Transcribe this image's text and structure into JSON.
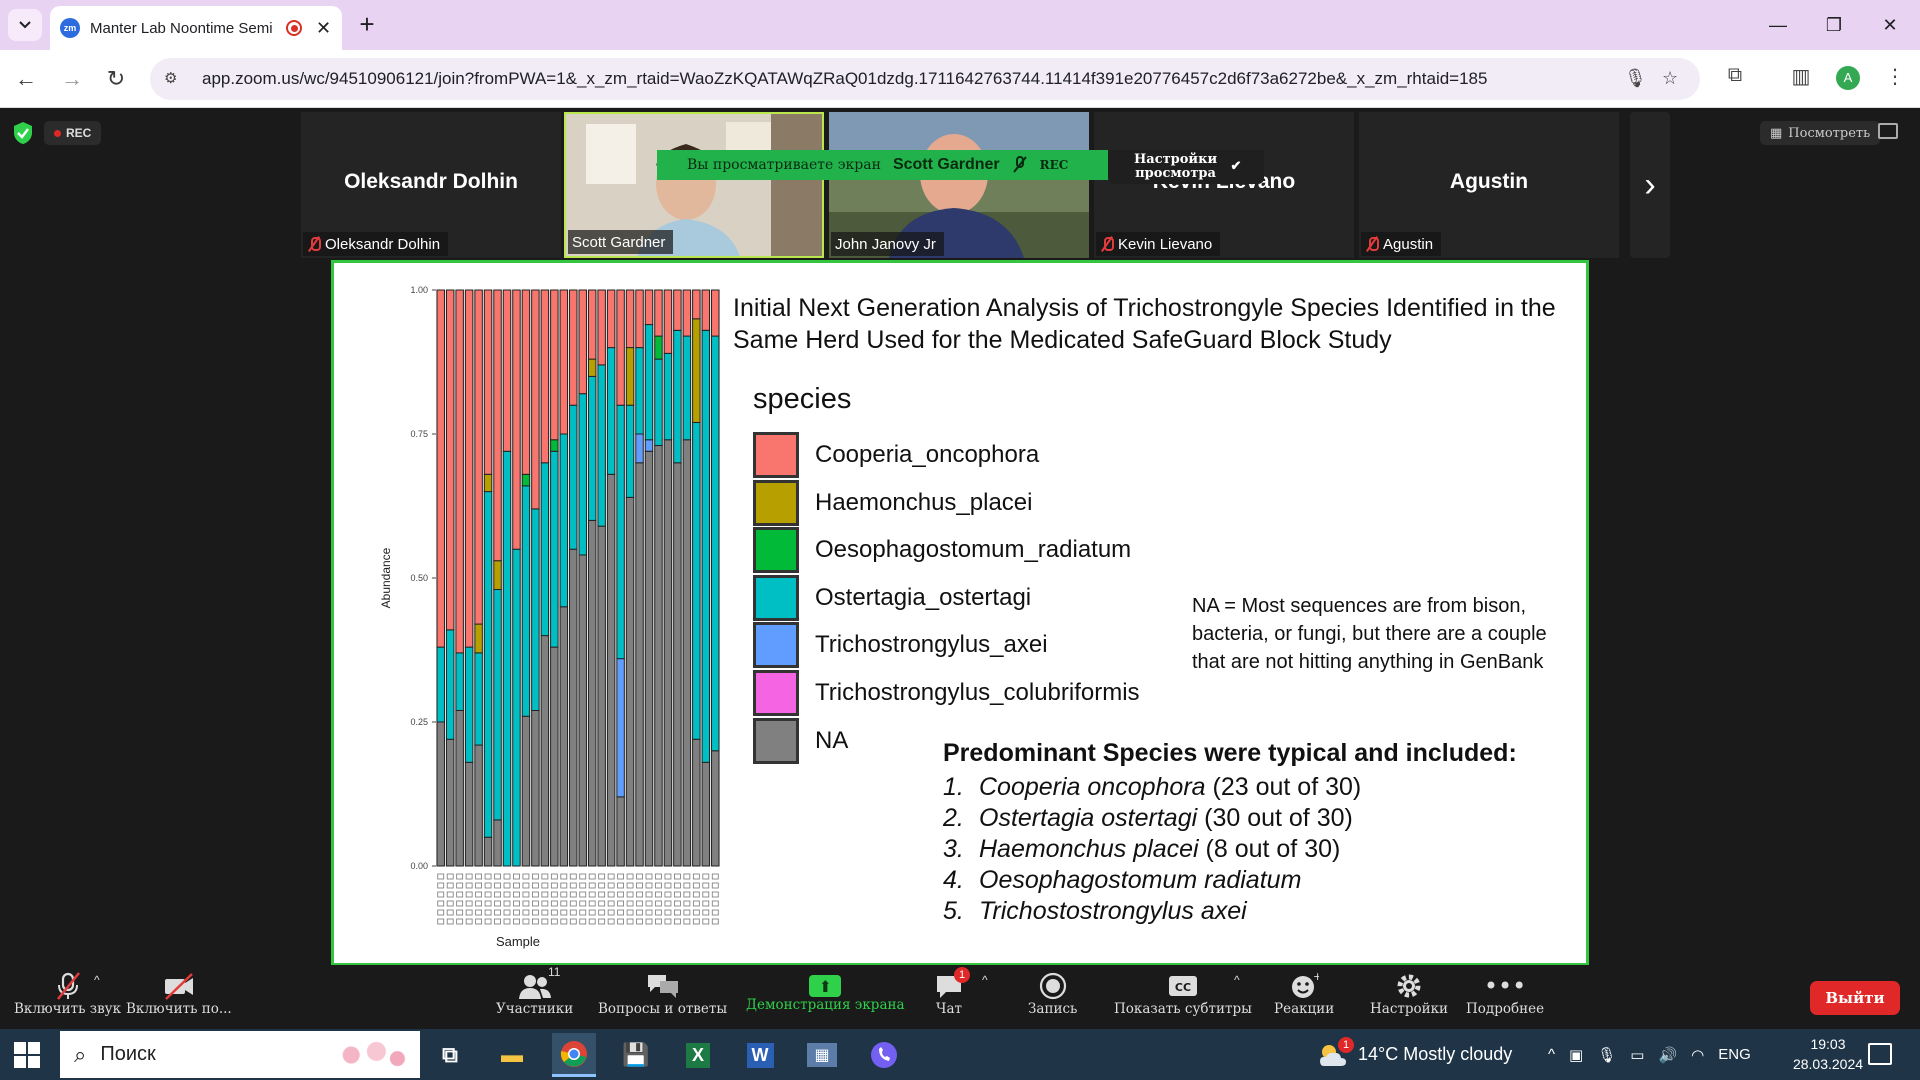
{
  "browser": {
    "tab_title": "Manter Lab Noontime Semi",
    "tab_favicon": "zm",
    "url": "app.zoom.us/wc/94510906121/join?fromPWA=1&_x_zm_rtaid=WaoZzKQATAWqZRaQ01dzdg.1711642763744.11414f391e20776457c2d6f73a6272be&_x_zm_rhtaid=185",
    "profile_initial": "A"
  },
  "meeting": {
    "rec_label": "REC",
    "view_label": "Посмотреть",
    "participants": [
      {
        "name_big": "Oleksandr Dolhin",
        "label": "Oleksandr Dolhin",
        "muted": true,
        "video": false
      },
      {
        "name_big": "",
        "label": "Scott Gardner",
        "muted": false,
        "video": true
      },
      {
        "name_big": "",
        "label": "John Janovy Jr",
        "muted": false,
        "video": true
      },
      {
        "name_big": "Kevin Lievano",
        "label": "Kevin Lievano",
        "muted": true,
        "video": false
      },
      {
        "name_big": "Agustin",
        "label": "Agustin",
        "muted": true,
        "video": false
      }
    ],
    "share_banner": {
      "viewing_text": "Вы просматриваете экран",
      "presenter": "Scott Gardner",
      "rec": "REC",
      "view_settings": "Настройки просмотра"
    }
  },
  "slide": {
    "title": "Initial Next Generation Analysis of Trichostrongyle Species Identified in the Same Herd Used for the Medicated SafeGuard Block Study",
    "legend_title": "species",
    "legend": [
      {
        "label": "Cooperia_oncophora",
        "color": "#f8766d"
      },
      {
        "label": "Haemonchus_placei",
        "color": "#b79f00"
      },
      {
        "label": "Oesophagostomum_radiatum",
        "color": "#00ba38"
      },
      {
        "label": "Ostertagia_ostertagi",
        "color": "#00bfc4"
      },
      {
        "label": "Trichostrongylus_axei",
        "color": "#619cff"
      },
      {
        "label": "Trichostrongylus_colubriformis",
        "color": "#f564e3"
      },
      {
        "label": "NA",
        "color": "#808080"
      }
    ],
    "na_note": "NA = Most sequences are from bison, bacteria, or fungi, but there are a couple that are not hitting anything in GenBank",
    "predominant_title": "Predominant Species were typical and included:",
    "predominant": [
      {
        "num": "1.",
        "species": "Cooperia oncophora",
        "count": "(23 out of 30)"
      },
      {
        "num": "2.",
        "species": "Ostertagia ostertagi",
        "count": "(30 out of 30)"
      },
      {
        "num": "3.",
        "species": "Haemonchus placei",
        "count": "(8 out of 30)"
      },
      {
        "num": "4.",
        "species": "Oesophagostomum radiatum",
        "count": ""
      },
      {
        "num": "5.",
        "species": "Trichostostrongylus axei",
        "count": ""
      }
    ]
  },
  "chart_data": {
    "type": "bar",
    "stacked": true,
    "title": "",
    "xlabel": "Sample",
    "ylabel": "Abundance",
    "ylim": [
      0,
      1
    ],
    "yticks": [
      "0.00",
      "0.25",
      "0.50",
      "0.75",
      "1.00"
    ],
    "series_order": [
      "NA",
      "Trichostrongylus_colubriformis",
      "Trichostrongylus_axei",
      "Ostertagia_ostertagi",
      "Oesophagostomum_radiatum",
      "Haemonchus_placei",
      "Cooperia_oncophora"
    ],
    "samples": [
      {
        "NA": 0.25,
        "Ostertagia_ostertagi": 0.13,
        "Cooperia_oncophora": 0.62
      },
      {
        "NA": 0.22,
        "Ostertagia_ostertagi": 0.19,
        "Cooperia_oncophora": 0.59
      },
      {
        "NA": 0.27,
        "Ostertagia_ostertagi": 0.1,
        "Cooperia_oncophora": 0.63
      },
      {
        "NA": 0.18,
        "Ostertagia_ostertagi": 0.2,
        "Cooperia_oncophora": 0.62
      },
      {
        "NA": 0.21,
        "Ostertagia_ostertagi": 0.16,
        "Haemonchus_placei": 0.05,
        "Cooperia_oncophora": 0.58
      },
      {
        "NA": 0.05,
        "Ostertagia_ostertagi": 0.6,
        "Haemonchus_placei": 0.03,
        "Cooperia_oncophora": 0.32
      },
      {
        "NA": 0.08,
        "Ostertagia_ostertagi": 0.4,
        "Haemonchus_placei": 0.05,
        "Cooperia_oncophora": 0.47
      },
      {
        "NA": 0.0,
        "Ostertagia_ostertagi": 0.72,
        "Cooperia_oncophora": 0.28
      },
      {
        "NA": 0.0,
        "Ostertagia_ostertagi": 0.55,
        "Cooperia_oncophora": 0.45
      },
      {
        "NA": 0.26,
        "Ostertagia_ostertagi": 0.4,
        "Oesophagostomum_radiatum": 0.02,
        "Cooperia_oncophora": 0.32
      },
      {
        "NA": 0.27,
        "Ostertagia_ostertagi": 0.35,
        "Cooperia_oncophora": 0.38
      },
      {
        "NA": 0.4,
        "Ostertagia_ostertagi": 0.3,
        "Cooperia_oncophora": 0.3
      },
      {
        "NA": 0.38,
        "Ostertagia_ostertagi": 0.34,
        "Oesophagostomum_radiatum": 0.02,
        "Cooperia_oncophora": 0.26
      },
      {
        "NA": 0.45,
        "Ostertagia_ostertagi": 0.3,
        "Cooperia_oncophora": 0.25
      },
      {
        "NA": 0.55,
        "Ostertagia_ostertagi": 0.25,
        "Cooperia_oncophora": 0.2
      },
      {
        "NA": 0.54,
        "Ostertagia_ostertagi": 0.28,
        "Cooperia_oncophora": 0.18
      },
      {
        "NA": 0.6,
        "Ostertagia_ostertagi": 0.25,
        "Haemonchus_placei": 0.03,
        "Cooperia_oncophora": 0.12
      },
      {
        "NA": 0.59,
        "Ostertagia_ostertagi": 0.28,
        "Cooperia_oncophora": 0.13
      },
      {
        "NA": 0.68,
        "Ostertagia_ostertagi": 0.22,
        "Cooperia_oncophora": 0.1
      },
      {
        "NA": 0.12,
        "Trichostrongylus_axei": 0.24,
        "Ostertagia_ostertagi": 0.44,
        "Cooperia_oncophora": 0.2
      },
      {
        "NA": 0.64,
        "Ostertagia_ostertagi": 0.16,
        "Haemonchus_placei": 0.1,
        "Cooperia_oncophora": 0.1
      },
      {
        "NA": 0.7,
        "Trichostrongylus_axei": 0.05,
        "Ostertagia_ostertagi": 0.15,
        "Cooperia_oncophora": 0.1
      },
      {
        "NA": 0.72,
        "Trichostrongylus_axei": 0.02,
        "Ostertagia_ostertagi": 0.2,
        "Cooperia_oncophora": 0.06
      },
      {
        "NA": 0.73,
        "Oesophagostomum_radiatum": 0.04,
        "Ostertagia_ostertagi": 0.15,
        "Cooperia_oncophora": 0.08
      },
      {
        "NA": 0.74,
        "Ostertagia_ostertagi": 0.15,
        "Cooperia_oncophora": 0.11
      },
      {
        "NA": 0.7,
        "Ostertagia_ostertagi": 0.23,
        "Cooperia_oncophora": 0.07
      },
      {
        "NA": 0.74,
        "Ostertagia_ostertagi": 0.18,
        "Cooperia_oncophora": 0.08
      },
      {
        "NA": 0.22,
        "Haemonchus_placei": 0.18,
        "Ostertagia_ostertagi": 0.55,
        "Cooperia_oncophora": 0.05
      },
      {
        "NA": 0.18,
        "Ostertagia_ostertagi": 0.75,
        "Cooperia_oncophora": 0.07
      },
      {
        "NA": 0.2,
        "Ostertagia_ostertagi": 0.72,
        "Cooperia_oncophora": 0.08
      }
    ]
  },
  "controls": [
    {
      "label": "Включить звук",
      "icon": "mic-off-icon"
    },
    {
      "label": "Включить по...",
      "icon": "video-off-icon"
    },
    {
      "label": "Участники",
      "icon": "participants-icon",
      "count": "11"
    },
    {
      "label": "Вопросы и ответы",
      "icon": "qa-icon"
    },
    {
      "label": "Демонстрация экрана",
      "icon": "share-screen-icon"
    },
    {
      "label": "Чат",
      "icon": "chat-icon",
      "badge": "1"
    },
    {
      "label": "Запись",
      "icon": "record-icon"
    },
    {
      "label": "Показать субтитры",
      "icon": "cc-icon"
    },
    {
      "label": "Реакции",
      "icon": "reaction-icon"
    },
    {
      "label": "Настройки",
      "icon": "settings-icon"
    },
    {
      "label": "Подробнее",
      "icon": "more-icon"
    }
  ],
  "leave_label": "Выйти",
  "taskbar": {
    "search_placeholder": "Поиск",
    "weather": "14°C  Mostly cloudy",
    "weather_badge": "1",
    "lang": "ENG",
    "time": "19:03",
    "date": "28.03.2024"
  }
}
